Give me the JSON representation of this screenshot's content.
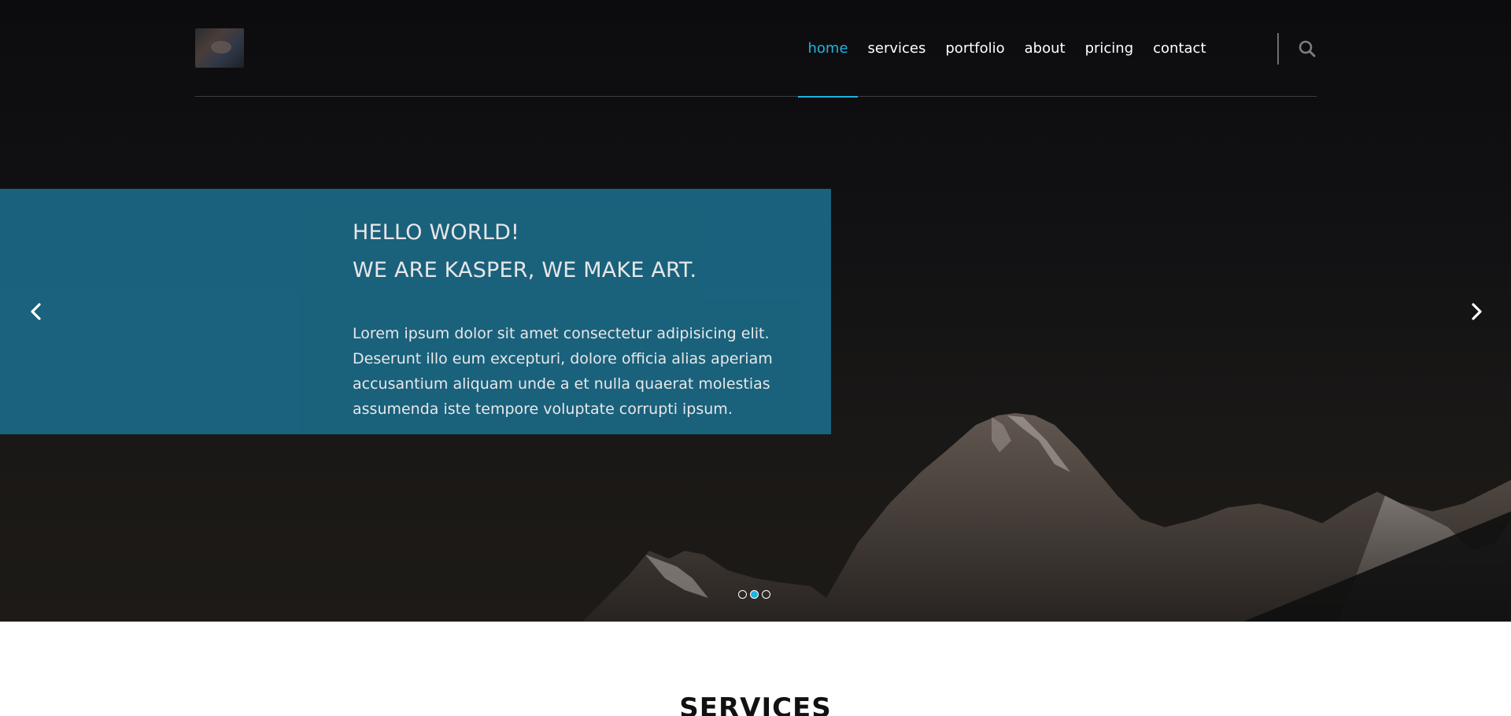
{
  "header": {
    "nav": [
      {
        "label": "home",
        "active": true
      },
      {
        "label": "services",
        "active": false
      },
      {
        "label": "portfolio",
        "active": false
      },
      {
        "label": "about",
        "active": false
      },
      {
        "label": "pricing",
        "active": false
      },
      {
        "label": "contact",
        "active": false
      }
    ],
    "search_icon": "search-icon"
  },
  "hero": {
    "title_line1": "HELLO WORLD!",
    "title_line2": "WE ARE KASPER, WE MAKE ART.",
    "text": "Lorem ipsum dolor sit amet consectetur adipisicing elit. Deserunt illo eum excepturi, dolore officia alias aperiam accusantium aliquam unde a et nulla quaerat molestias assumenda iste tempore voluptate corrupti ipsum.",
    "slides": 3,
    "active_slide": 2,
    "prev_icon": "chevron-left-icon",
    "next_icon": "chevron-right-icon"
  },
  "services": {
    "title": "SERVICES"
  },
  "colors": {
    "accent": "#1fb4e0",
    "caption_bg": "#1b6a88",
    "header_bg": "#0c0c0e"
  }
}
